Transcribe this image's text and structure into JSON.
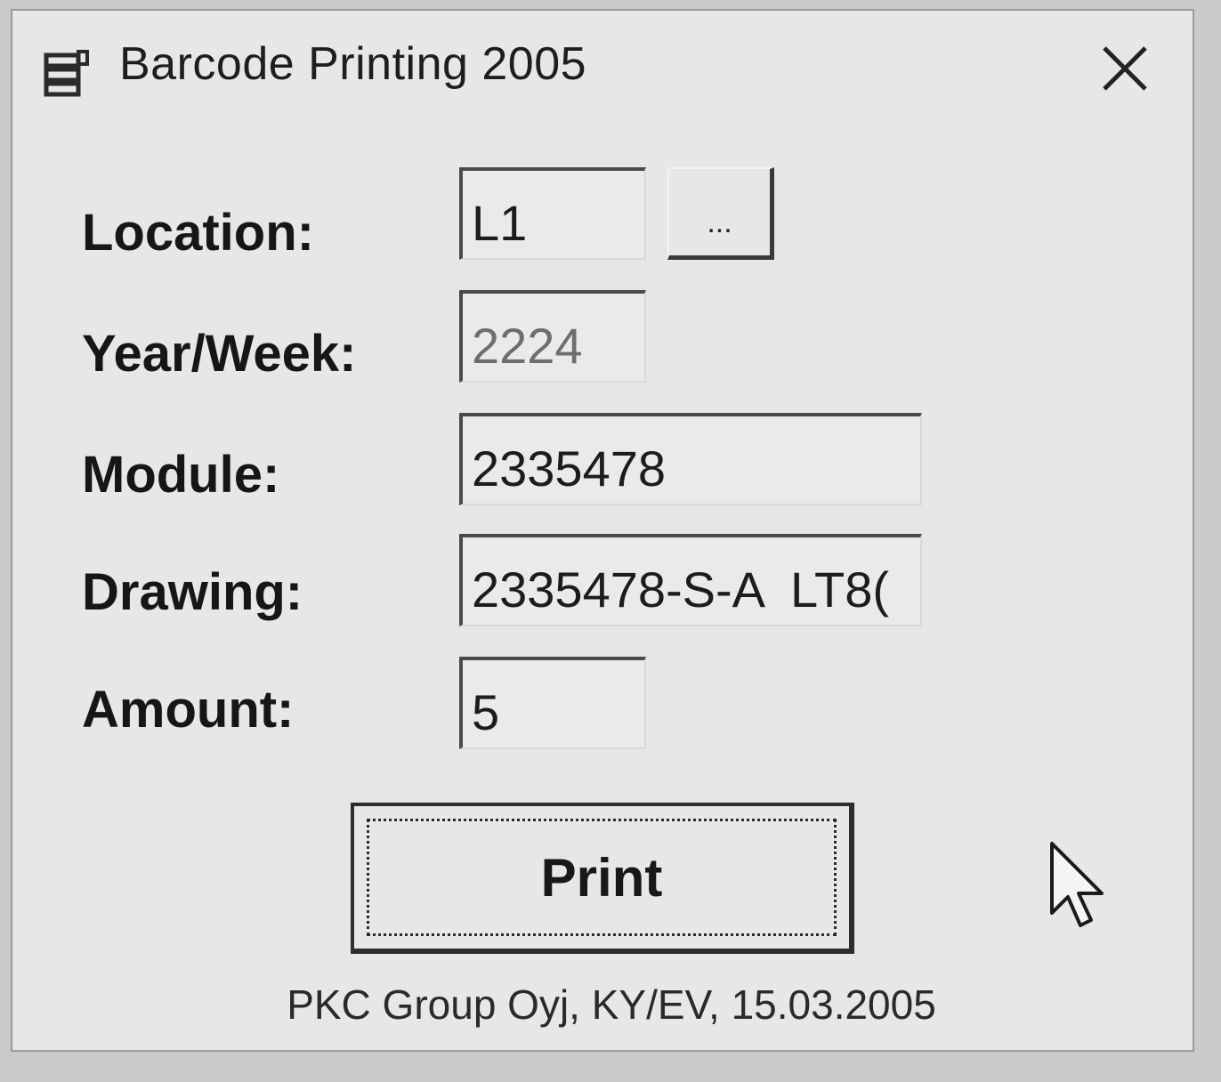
{
  "window": {
    "title": "Barcode Printing 2005"
  },
  "form": {
    "location": {
      "label": "Location:",
      "value": "L1",
      "browse_label": "..."
    },
    "year_week": {
      "label": "Year/Week:",
      "value": "2224"
    },
    "module": {
      "label": "Module:",
      "value": "2335478"
    },
    "drawing": {
      "label": "Drawing:",
      "value": "2335478-S-A  LT8("
    },
    "amount": {
      "label": "Amount:",
      "value": "5"
    }
  },
  "actions": {
    "print_label": "Print"
  },
  "footer": {
    "text": "PKC Group Oyj, KY/EV, 15.03.2005"
  },
  "icons": {
    "app": "database-icon",
    "close": "close-icon",
    "pointer": "mouse-cursor-icon"
  }
}
